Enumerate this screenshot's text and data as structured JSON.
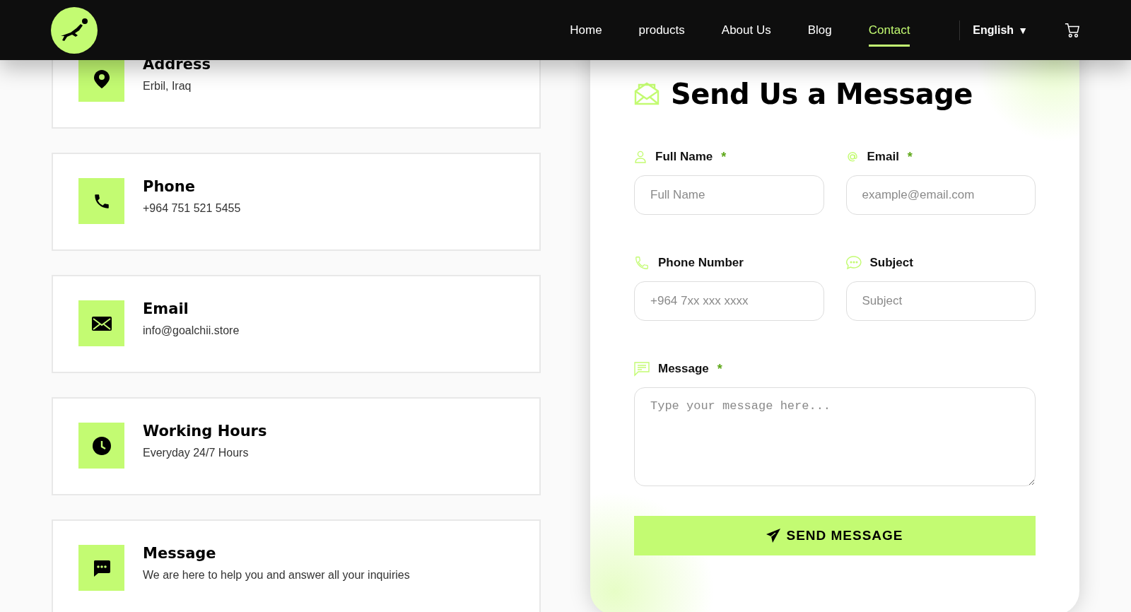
{
  "header": {
    "nav": [
      {
        "label": "Home",
        "selected": false
      },
      {
        "label": "products",
        "selected": false
      },
      {
        "label": "About Us",
        "selected": false
      },
      {
        "label": "Blog",
        "selected": false
      },
      {
        "label": "Contact",
        "selected": true
      }
    ],
    "language": {
      "label": "English",
      "caret": "▼"
    }
  },
  "contact_cards": [
    {
      "title": "Address",
      "value": "Erbil, Iraq"
    },
    {
      "title": "Phone",
      "value": "+964 751 521 5455"
    },
    {
      "title": "Email",
      "value": "info@goalchii.store"
    },
    {
      "title": "Working Hours",
      "value": "Everyday 24/7 Hours"
    },
    {
      "title": "Message",
      "value": "We are here to help you and answer all your inquiries"
    }
  ],
  "form": {
    "title": "Send Us a Message",
    "fields": [
      {
        "kind": "input",
        "label": "Full Name",
        "required_mark": "*",
        "placeholder": "Full Name"
      },
      {
        "kind": "input",
        "label": "Email",
        "required_mark": "*",
        "placeholder": "example@email.com"
      },
      {
        "kind": "input",
        "label": "Phone Number",
        "placeholder": "+964 7xx xxx xxxx"
      },
      {
        "kind": "input",
        "label": "Subject",
        "placeholder": "Subject"
      },
      {
        "kind": "textarea",
        "label": "Message",
        "required_mark": "*",
        "placeholder": "Type your message here..."
      }
    ],
    "submit": "SEND MESSAGE"
  }
}
